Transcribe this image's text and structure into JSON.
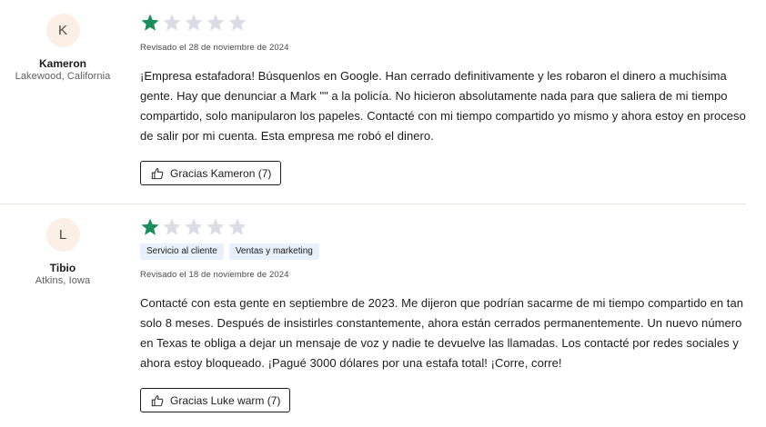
{
  "reviews": [
    {
      "avatar_initial": "K",
      "name": "Kameron",
      "location": "Lakewood, California",
      "rating": 1,
      "max_rating": 5,
      "tags": [],
      "date": "Revisado el 28 de noviembre de 2024",
      "body": "¡Empresa estafadora! Búsquenlos en Google. Han cerrado definitivamente y les robaron el dinero a muchísima gente. Hay que denunciar a Mark \"\" a la policía. No hicieron absolutamente nada para que saliera de mi tiempo compartido, solo manipularon los papeles. Contacté con mi tiempo compartido yo mismo y ahora estoy en proceso de salir por mi cuenta. Esta empresa me robó el dinero.",
      "helpful_label": "Gracias Kameron (7)"
    },
    {
      "avatar_initial": "L",
      "name": "Tibio",
      "location": "Atkins, Iowa",
      "rating": 1,
      "max_rating": 5,
      "tags": [
        "Servicio al cliente",
        "Ventas y marketing"
      ],
      "date": "Revisado el 18 de noviembre de 2024",
      "body": "Contacté con esta gente en septiembre de 2023. Me dijeron que podrían sacarme de mi tiempo compartido en tan solo 8 meses. Después de insistirles constantemente, ahora están cerrados permanentemente. Un nuevo número en Texas te obliga a dejar un mensaje de voz y nadie te devuelve las llamadas. Los contacté por redes sociales y ahora estoy bloqueado. ¡Pagué 3000 dólares por una estafa total! ¡Corre, corre!",
      "helpful_label": "Gracias Luke warm (7)"
    }
  ],
  "colors": {
    "star_filled": "#1a8f5c",
    "star_empty": "#dcdce6",
    "tag_background": "#e8f1fb",
    "avatar_background": "#fcefe6"
  },
  "icons": {
    "star": "star-icon",
    "helpful": "thumbs-up-icon"
  }
}
